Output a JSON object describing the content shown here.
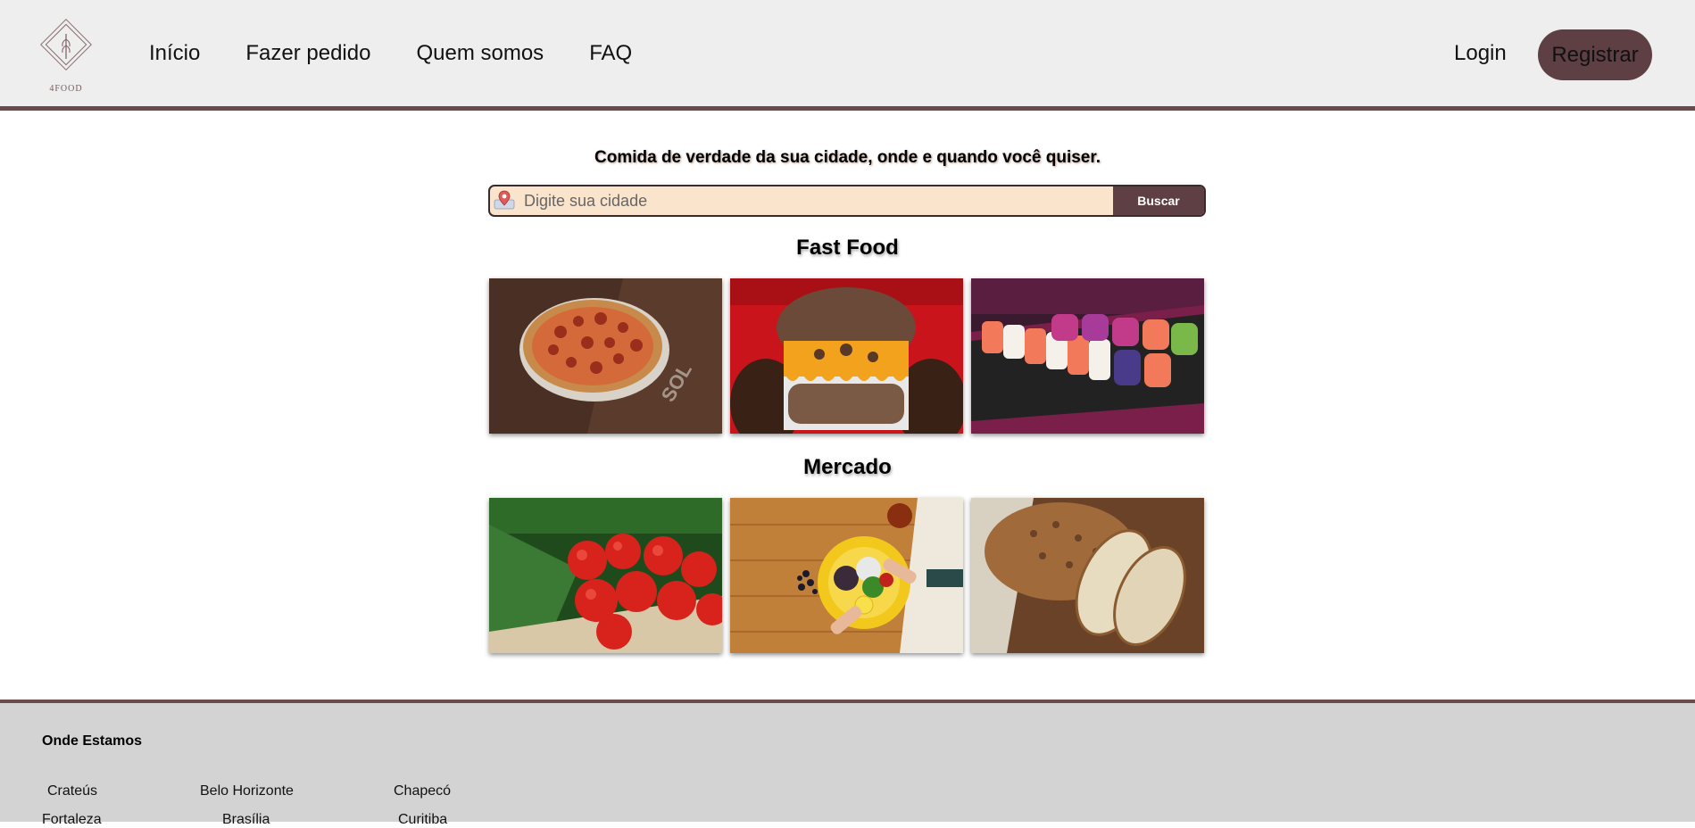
{
  "brand": {
    "logo_text": "4FOOD"
  },
  "nav": {
    "items": [
      {
        "label": "Início"
      },
      {
        "label": "Fazer pedido"
      },
      {
        "label": "Quem somos"
      },
      {
        "label": "FAQ"
      }
    ],
    "login_label": "Login",
    "register_label": "Registrar"
  },
  "hero": {
    "tagline": "Comida de verdade da sua cidade, onde e quando você quiser.",
    "search_placeholder": "Digite sua cidade",
    "search_value": "",
    "search_button": "Buscar"
  },
  "sections": [
    {
      "title": "Fast Food",
      "tiles": [
        "pizza",
        "burger",
        "sushi"
      ]
    },
    {
      "title": "Mercado",
      "tiles": [
        "tomatoes",
        "salad",
        "bread"
      ]
    }
  ],
  "footer": {
    "title": "Onde Estamos",
    "cities": [
      "Crateús",
      "Belo Horizonte",
      "Chapecó",
      "Fortaleza",
      "Brasília",
      "Curitiba"
    ]
  },
  "colors": {
    "accent": "#5e3f43",
    "header_bg": "#eeeeee",
    "search_bg": "#fbe4cc",
    "footer_bg": "#d3d3d3"
  }
}
